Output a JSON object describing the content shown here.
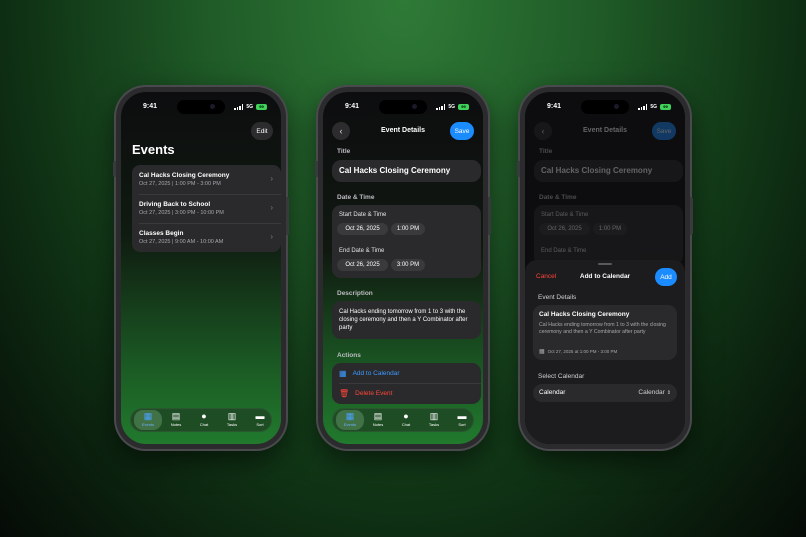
{
  "status": {
    "time": "9:41",
    "network": "5G",
    "battery": "99"
  },
  "colors": {
    "accent": "#1a8cff",
    "danger": "#ff453a",
    "background": "#1f5a27"
  },
  "tabs": [
    {
      "label": "Events",
      "icon": "calendar-icon",
      "glyph": "▦"
    },
    {
      "label": "Notes",
      "icon": "note-icon",
      "glyph": "▤"
    },
    {
      "label": "Chat",
      "icon": "chat-bubble-icon",
      "glyph": "●"
    },
    {
      "label": "Tasks",
      "icon": "clipboard-icon",
      "glyph": "▥"
    },
    {
      "label": "Sort",
      "icon": "tray-icon",
      "glyph": "▬"
    }
  ],
  "events_screen": {
    "edit_label": "Edit",
    "title": "Events",
    "items": [
      {
        "title": "Cal Hacks Closing Ceremony",
        "detail": "Oct 27, 2025 | 1:00 PM - 3:00 PM"
      },
      {
        "title": "Driving Back to School",
        "detail": "Oct 27, 2025 | 3:00 PM - 10:00 PM"
      },
      {
        "title": "Classes Begin",
        "detail": "Oct 27, 2025 | 9:00 AM - 10:00 AM"
      }
    ]
  },
  "details_screen": {
    "nav_title": "Event Details",
    "save_label": "Save",
    "title_section": "Title",
    "title_value": "Cal Hacks Closing Ceremony",
    "datetime_section": "Date & Time",
    "start_label": "Start Date & Time",
    "start_date": "Oct 26, 2025",
    "start_time": "1:00 PM",
    "end_label": "End Date & Time",
    "end_date": "Oct 26, 2025",
    "end_time": "3:00 PM",
    "description_section": "Description",
    "description": "Cal Hacks ending tomorrow from 1 to 3 with the closing ceremony and then a Y Combinator after party",
    "actions_section": "Actions",
    "add_to_calendar": "Add to Calendar",
    "delete_event": "Delete Event"
  },
  "sheet": {
    "cancel_label": "Cancel",
    "title": "Add to Calendar",
    "add_label": "Add",
    "event_details_section": "Event Details",
    "event_title": "Cal Hacks Closing Ceremony",
    "event_description": "Cal Hacks ending tomorrow from 1 to 3 with the closing ceremony and then a Y Combinator after party",
    "event_when": "Oct 27, 2025 at 1:00 PM - 3:00 PM",
    "select_calendar_section": "Select Calendar",
    "calendar_label": "Calendar",
    "calendar_value": "Calendar"
  }
}
